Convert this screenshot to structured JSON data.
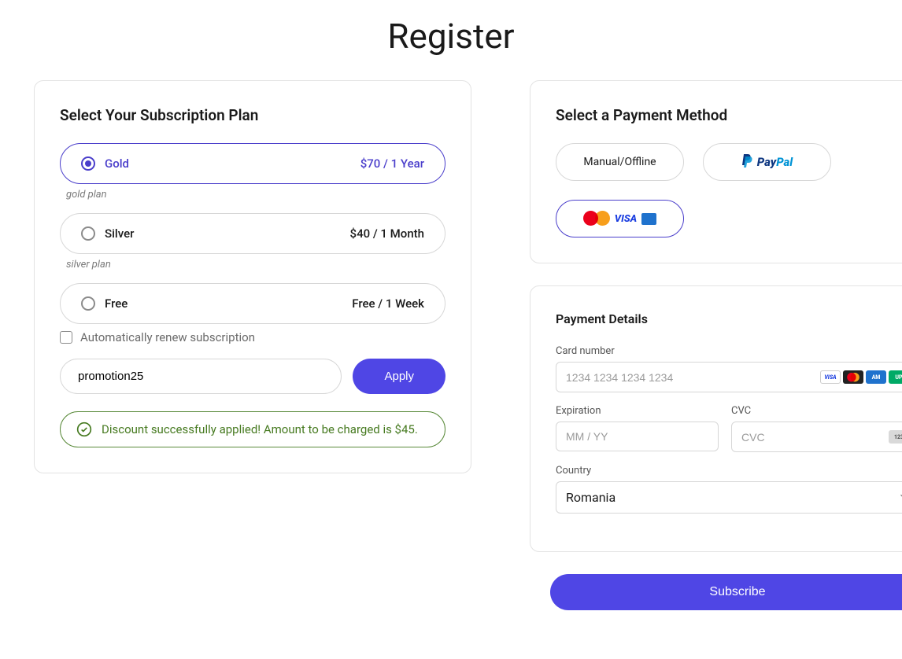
{
  "page_title": "Register",
  "subscription_panel": {
    "title": "Select Your Subscription Plan",
    "plans": [
      {
        "name": "Gold",
        "price": "$70 / 1 Year",
        "description": "gold plan",
        "selected": true
      },
      {
        "name": "Silver",
        "price": "$40 / 1 Month",
        "description": "silver plan",
        "selected": false
      },
      {
        "name": "Free",
        "price": "Free / 1 Week",
        "description": "",
        "selected": false
      }
    ],
    "auto_renew_label": "Automatically renew subscription",
    "auto_renew_checked": false,
    "coupon_value": "promotion25",
    "apply_label": "Apply",
    "success_message": "Discount successfully applied! Amount to be charged is $45."
  },
  "payment_method_panel": {
    "title": "Select a Payment Method",
    "methods": {
      "manual_label": "Manual/Offline",
      "paypal_name": "paypal",
      "cards_name": "cards",
      "selected": "cards"
    }
  },
  "payment_details_panel": {
    "title": "Payment Details",
    "card_number_label": "Card number",
    "card_number_placeholder": "1234 1234 1234 1234",
    "expiration_label": "Expiration",
    "expiration_placeholder": "MM / YY",
    "cvc_label": "CVC",
    "cvc_placeholder": "CVC",
    "country_label": "Country",
    "country_value": "Romania"
  },
  "subscribe_label": "Subscribe",
  "colors": {
    "accent": "#4f46e5",
    "success": "#467a20"
  }
}
